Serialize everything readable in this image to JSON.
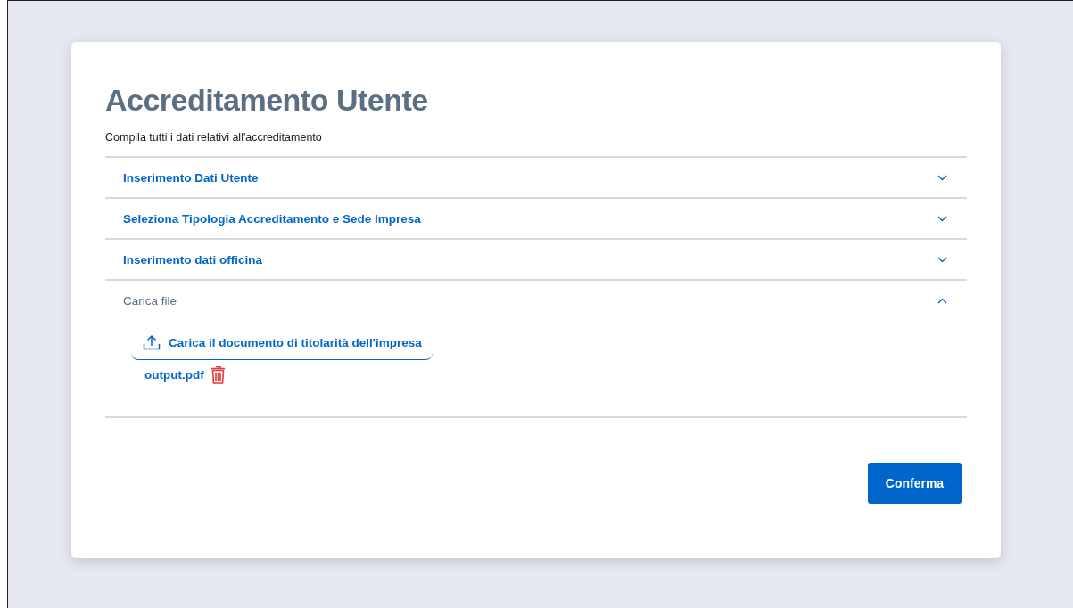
{
  "page": {
    "title": "Accreditamento Utente",
    "subtitle": "Compila tutti i dati relativi all'accreditamento"
  },
  "sections": [
    {
      "title": "Inserimento Dati Utente",
      "expanded": false
    },
    {
      "title": "Seleziona Tipologia Accreditamento e Sede Impresa",
      "expanded": false
    },
    {
      "title": "Inserimento dati officina",
      "expanded": false
    },
    {
      "title": "Carica file",
      "expanded": true,
      "upload_button": "Carica il documento di titolarità dell'impresa",
      "files": [
        "output.pdf"
      ]
    }
  ],
  "buttons": [
    "Conferma"
  ]
}
